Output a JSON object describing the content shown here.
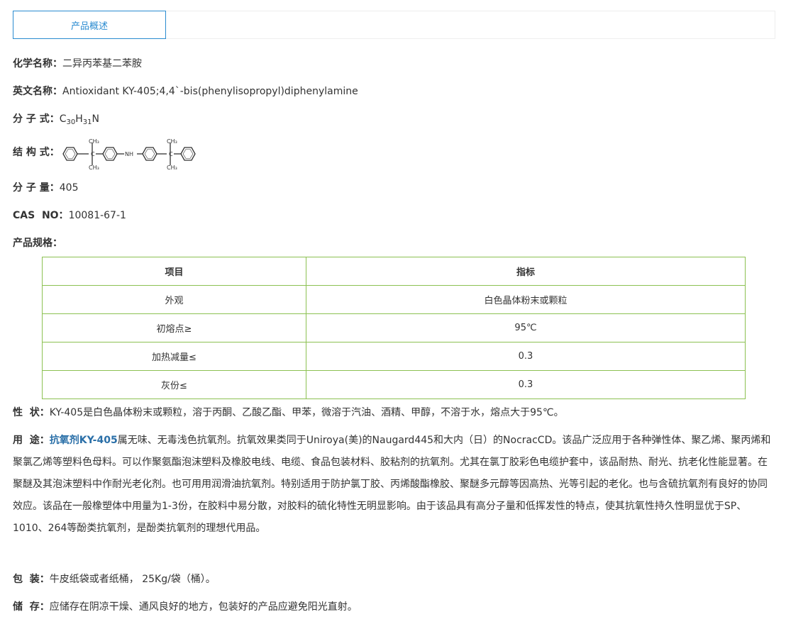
{
  "tab": {
    "label": "产品概述"
  },
  "fields": {
    "chem_name": {
      "label": "化学名称：",
      "value": "二异丙苯基二苯胺"
    },
    "eng_name": {
      "label": "英文名称：",
      "value": "Antioxidant KY-405;4,4`-bis(phenylisopropyl)diphenylamine"
    },
    "formula": {
      "label": "分 子 式：",
      "c": "C",
      "c_sub": "30",
      "h": "H",
      "h_sub": "31",
      "n": "N"
    },
    "structure": {
      "label": "结 构 式：",
      "ch3": "CH₃",
      "nh": "NH"
    },
    "mw": {
      "label": "分 子 量：",
      "value": "405"
    },
    "cas": {
      "label": "CAS  NO：",
      "value": "10081-67-1"
    },
    "spec": {
      "label": "产品规格："
    }
  },
  "table": {
    "headers": [
      "项目",
      "指标"
    ],
    "rows": [
      [
        "外观",
        "白色晶体粉末或颗粒"
      ],
      [
        "初熔点≥",
        "95℃"
      ],
      [
        "加热减量≤",
        "0.3"
      ],
      [
        "灰份≤",
        "0.3"
      ]
    ]
  },
  "properties": {
    "label": "性  状：",
    "value": "KY-405是白色晶体粉末或颗粒，溶于丙酮、乙酸乙酯、甲苯，微溶于汽油、酒精、甲醇，不溶于水，熔点大于95℃。"
  },
  "usage": {
    "label": "用  途：",
    "link": "抗氧剂KY-405",
    "text": "属无味、无毒浅色抗氧剂。抗氧效果类同于Uniroya(美)的Naugard445和大内（日）的NocracCD。该品广泛应用于各种弹性体、聚乙烯、聚丙烯和聚氯乙烯等塑料色母料。可以作聚氨酯泡沫塑料及橡胶电线、电缆、食品包装材料、胶粘剂的抗氧剂。尤其在氯丁胶彩色电缆护套中，该品耐热、耐光、抗老化性能显著。在聚醚及其泡沫塑料中作耐光老化剂。也可用用润滑油抗氧剂。特别适用于防护氯丁胶、丙烯酸酯橡胶、聚醚多元醇等因高热、光等引起的老化。也与含硫抗氧剂有良好的协同效应。该品在一般橡塑体中用量为1-3份，在胶料中易分散，对胶料的硫化特性无明显影响。由于该品具有高分子量和低挥发性的特点，使其抗氧性持久性明显优于SP、1010、264等酚类抗氧剂，是酚类抗氧剂的理想代用品。"
  },
  "packaging": {
    "label": "包  装：",
    "value": "牛皮纸袋或者纸桶， 25Kg/袋（桶）。"
  },
  "storage": {
    "label": "储  存：",
    "value": "应储存在阴凉干燥、通风良好的地方，包装好的产品应避免阳光直射。"
  }
}
